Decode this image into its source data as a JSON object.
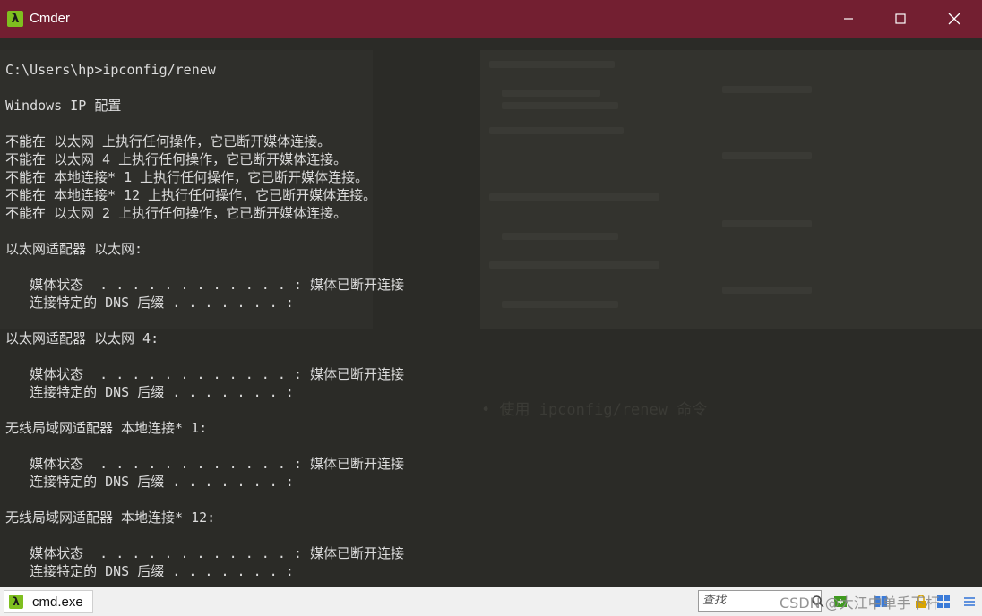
{
  "window": {
    "title": "Cmder",
    "app_icon": "λ"
  },
  "terminal_lines": [
    "C:\\Users\\hp>ipconfig/renew",
    "",
    "Windows IP 配置",
    "",
    "不能在 以太网 上执行任何操作，它已断开媒体连接。",
    "不能在 以太网 4 上执行任何操作，它已断开媒体连接。",
    "不能在 本地连接* 1 上执行任何操作，它已断开媒体连接。",
    "不能在 本地连接* 12 上执行任何操作，它已断开媒体连接。",
    "不能在 以太网 2 上执行任何操作，它已断开媒体连接。",
    "",
    "以太网适配器 以太网:",
    "",
    "   媒体状态  . . . . . . . . . . . . : 媒体已断开连接",
    "   连接特定的 DNS 后缀 . . . . . . . :",
    "",
    "以太网适配器 以太网 4:",
    "",
    "   媒体状态  . . . . . . . . . . . . : 媒体已断开连接",
    "   连接特定的 DNS 后缀 . . . . . . . :",
    "",
    "无线局域网适配器 本地连接* 1:",
    "",
    "   媒体状态  . . . . . . . . . . . . : 媒体已断开连接",
    "   连接特定的 DNS 后缀 . . . . . . . :",
    "",
    "无线局域网适配器 本地连接* 12:",
    "",
    "   媒体状态  . . . . . . . . . . . . : 媒体已断开连接",
    "   连接特定的 DNS 后缀 . . . . . . . :"
  ],
  "statusbar": {
    "tab_icon": "λ",
    "tab_label": "cmd.exe",
    "search_placeholder": "查找",
    "watermark": "CSDN @大江中单手下杆"
  },
  "ghost_text": "• 使用 ipconfig/renew 命令",
  "colors": {
    "titlebar": "#731f31",
    "background": "#2b2b27",
    "text": "#dcdcdc",
    "accent": "#7fbf1f"
  }
}
